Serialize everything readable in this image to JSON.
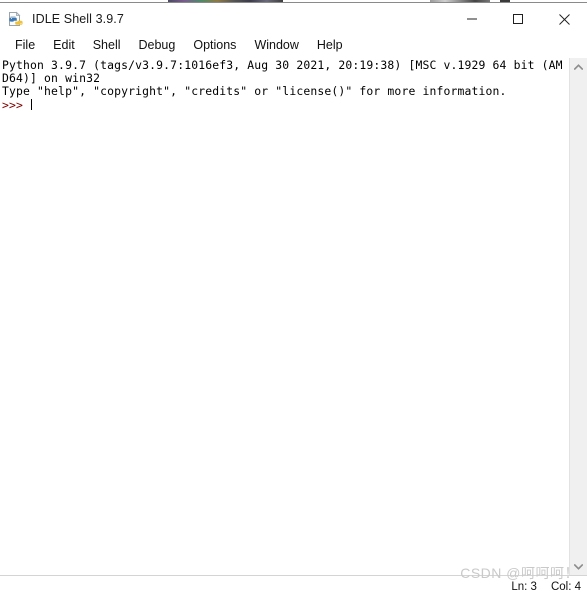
{
  "window": {
    "title": "IDLE Shell 3.9.7",
    "icon": "idle-python-file-icon",
    "controls": {
      "minimize_label": "Minimize",
      "maximize_label": "Maximize",
      "close_label": "Close"
    }
  },
  "menubar": {
    "items": [
      {
        "label": "File"
      },
      {
        "label": "Edit"
      },
      {
        "label": "Shell"
      },
      {
        "label": "Debug"
      },
      {
        "label": "Options"
      },
      {
        "label": "Window"
      },
      {
        "label": "Help"
      }
    ]
  },
  "console": {
    "banner_line_1": "Python 3.9.7 (tags/v3.9.7:1016ef3, Aug 30 2021, 20:19:38) [MSC v.1929 64 bit (AM",
    "banner_line_2": "D64)] on win32",
    "banner_line_3": "Type \"help\", \"copyright\", \"credits\" or \"license()\" for more information.",
    "prompt": ">>> ",
    "prompt_color": "#7f0000",
    "text_color": "#000000",
    "background": "#ffffff"
  },
  "scrollbar": {
    "up_arrow": "chevron-up-icon",
    "down_arrow": "chevron-down-icon",
    "track_color": "#f0f0f0"
  },
  "statusbar": {
    "line_label": "Ln: 3",
    "col_label": "Col: 4"
  },
  "watermark": {
    "text": "CSDN @呵呵呵！"
  }
}
